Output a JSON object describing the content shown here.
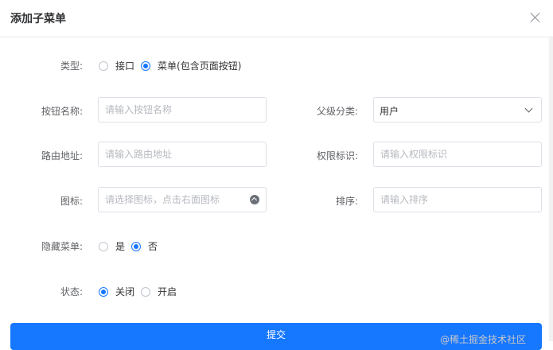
{
  "dialog": {
    "title": "添加子菜单"
  },
  "form": {
    "type": {
      "label": "类型:",
      "options": [
        "接口",
        "菜单(包含页面按钮)"
      ],
      "selected": 1
    },
    "button_name": {
      "label": "按钮名称:",
      "placeholder": "请输入按钮名称"
    },
    "parent_category": {
      "label": "父级分类:",
      "value": "用户"
    },
    "route_address": {
      "label": "路由地址:",
      "placeholder": "请输入路由地址"
    },
    "permission": {
      "label": "权限标识:",
      "placeholder": "请输入权限标识"
    },
    "icon": {
      "label": "图标:",
      "placeholder": "请选择图标，点击右面图标"
    },
    "sort": {
      "label": "排序:",
      "placeholder": "请输入排序"
    },
    "hide_menu": {
      "label": "隐藏菜单:",
      "options": [
        "是",
        "否"
      ],
      "selected": 1
    },
    "status": {
      "label": "状态:",
      "options": [
        "关闭",
        "开启"
      ],
      "selected": 0
    }
  },
  "submit_label": "提交",
  "watermark": "@稀土掘金技术社区",
  "colors": {
    "primary": "#1677ff",
    "border": "#dcdfe6"
  }
}
